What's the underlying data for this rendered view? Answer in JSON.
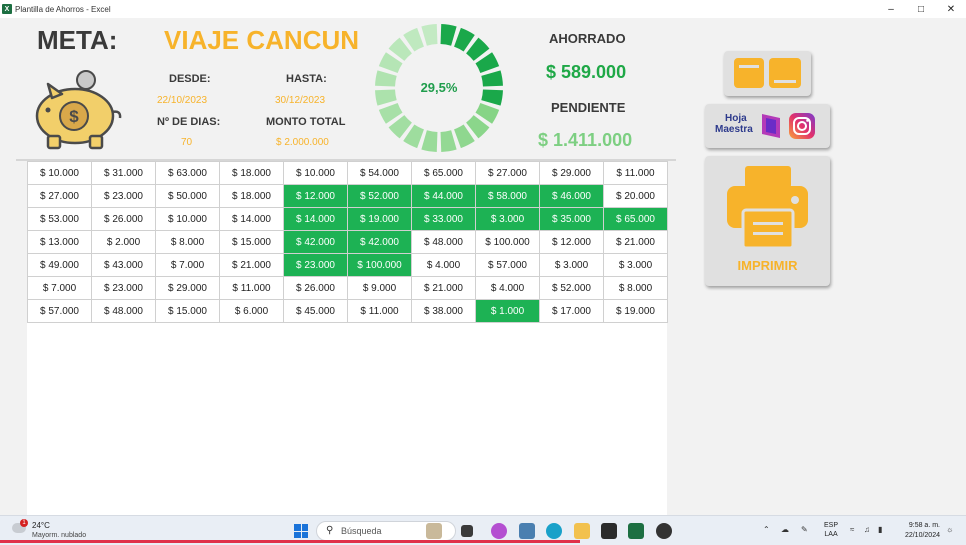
{
  "window": {
    "title": "Plantilla de Ahorros - Excel",
    "app_icon": "excel-icon",
    "controls": [
      "minimize",
      "maximize",
      "close"
    ]
  },
  "header": {
    "meta_label": "META:",
    "meta_value": "VIAJE CANCUN",
    "desde_label": "DESDE:",
    "desde_value": "22/10/2023",
    "hasta_label": "HASTA:",
    "hasta_value": "30/12/2023",
    "dias_label": "Nº DE DIAS:",
    "dias_value": "70",
    "monto_label": "MONTO TOTAL",
    "monto_value": "$ 2.000.000"
  },
  "progress": {
    "percent_text": "29,5%",
    "fraction": 0.295
  },
  "summary": {
    "ahorrado_label": "AHORRADO",
    "ahorrado_value": "$ 589.000",
    "pendiente_label": "PENDIENTE",
    "pendiente_value": "$ 1.411.000"
  },
  "buttons": {
    "brand_line1": "Hoja",
    "brand_line2": "Maestra",
    "print_label": "IMPRIMIR"
  },
  "grid": {
    "rows": [
      [
        "$ 10.000",
        "$ 31.000",
        "$ 63.000",
        "$ 18.000",
        "$ 10.000",
        "$ 54.000",
        "$ 65.000",
        "$ 27.000",
        "$ 29.000",
        "$ 11.000"
      ],
      [
        "$ 27.000",
        "$ 23.000",
        "$ 50.000",
        "$ 18.000",
        "$ 12.000",
        "$ 52.000",
        "$ 44.000",
        "$ 58.000",
        "$ 46.000",
        "$ 20.000"
      ],
      [
        "$ 53.000",
        "$ 26.000",
        "$ 10.000",
        "$ 14.000",
        "$ 14.000",
        "$ 19.000",
        "$ 33.000",
        "$ 3.000",
        "$ 35.000",
        "$ 65.000"
      ],
      [
        "$ 13.000",
        "$ 2.000",
        "$ 8.000",
        "$ 15.000",
        "$ 42.000",
        "$ 42.000",
        "$ 48.000",
        "$ 100.000",
        "$ 12.000",
        "$ 21.000"
      ],
      [
        "$ 49.000",
        "$ 43.000",
        "$ 7.000",
        "$ 21.000",
        "$ 23.000",
        "$ 100.000",
        "$ 4.000",
        "$ 57.000",
        "$ 3.000",
        "$ 3.000"
      ],
      [
        "$ 7.000",
        "$ 23.000",
        "$ 29.000",
        "$ 11.000",
        "$ 26.000",
        "$ 9.000",
        "$ 21.000",
        "$ 4.000",
        "$ 52.000",
        "$ 8.000"
      ],
      [
        "$ 57.000",
        "$ 48.000",
        "$ 15.000",
        "$ 6.000",
        "$ 45.000",
        "$ 11.000",
        "$ 38.000",
        "$ 1.000",
        "$ 17.000",
        "$ 19.000"
      ]
    ],
    "paid": [
      [
        false,
        false,
        false,
        false,
        false,
        false,
        false,
        false,
        false,
        false
      ],
      [
        false,
        false,
        false,
        false,
        true,
        true,
        true,
        true,
        true,
        false
      ],
      [
        false,
        false,
        false,
        false,
        true,
        true,
        true,
        true,
        true,
        true
      ],
      [
        false,
        false,
        false,
        false,
        true,
        true,
        false,
        false,
        false,
        false
      ],
      [
        false,
        false,
        false,
        false,
        true,
        true,
        false,
        false,
        false,
        false
      ],
      [
        false,
        false,
        false,
        false,
        false,
        false,
        false,
        false,
        false,
        false
      ],
      [
        false,
        false,
        false,
        false,
        false,
        false,
        false,
        true,
        false,
        false
      ]
    ],
    "paid_color": "#1db254"
  },
  "taskbar": {
    "temp": "24°C",
    "condition": "Mayorm. nublado",
    "weather_badge": "1",
    "search_placeholder": "Búsqueda",
    "lang_line1": "ESP",
    "lang_line2": "LAA",
    "time": "9:58 a. m.",
    "date": "22/10/2024"
  },
  "colors": {
    "accent_orange": "#f7b32b",
    "green_dark": "#1fa847",
    "green_light": "#7dcf82"
  }
}
